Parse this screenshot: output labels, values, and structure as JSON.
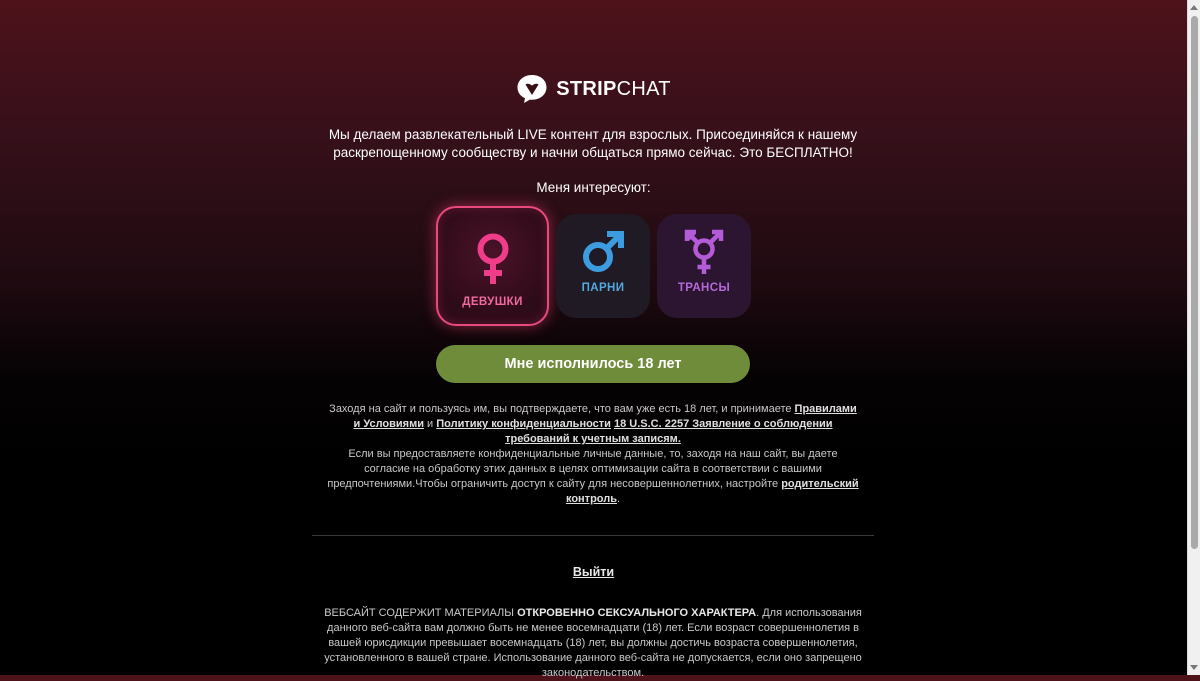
{
  "brand": {
    "name_bold": "STRIP",
    "name_regular": "CHAT",
    "logo_icon": "speech-bubble-heart-icon"
  },
  "intro": {
    "line1": "Мы делаем развлекательный LIVE контент для взрослых. Присоединяйся к нашему",
    "line2": "раскрепощенному сообществу и начни общаться прямо сейчас. Это БЕСПЛАТНО!"
  },
  "interests": {
    "label": "Меня интересуют:",
    "options": [
      {
        "label": "ДЕВУШКИ",
        "icon": "female-symbol-icon",
        "color": "#f03d8a",
        "selected": true
      },
      {
        "label": "ПАРНИ",
        "icon": "male-symbol-icon",
        "color": "#3d9be0",
        "selected": false
      },
      {
        "label": "ТРАНСЫ",
        "icon": "transgender-symbol-icon",
        "color": "#b45bd8",
        "selected": false
      }
    ]
  },
  "confirm_button": {
    "label": "Мне исполнилось 18 лет",
    "color": "#6e8c3a"
  },
  "legal": {
    "p1_start": "Заходя на сайт и пользуясь им, вы подтверждаете, что вам уже есть 18 лет, и принимаете ",
    "terms_link": "Правилами и Условиями",
    "p1_and": " и ",
    "privacy_link": "Политику конфиденциальности",
    "space": " ",
    "usc_link": "18 U.S.C. 2257 Заявление о соблюдении требований к учетным записям.",
    "p2_start": "Если вы предоставляете конфиденциальные личные данные, то, заходя на наш сайт, вы даете согласие на обработку этих данных в целях оптимизации сайта в соответствии с вашими предпочтениями.Чтобы ограничить доступ к сайту для несовершеннолетних, настройте ",
    "parental_link": "родительский контроль",
    "p2_end": "."
  },
  "exit": {
    "label": "Выйти"
  },
  "warning": {
    "start": "ВЕБСАЙТ СОДЕРЖИТ МАТЕРИАЛЫ ",
    "bold": "ОТКРОВЕННО СЕКСУАЛЬНОГО ХАРАКТЕРА",
    "rest": ". Для использования данного веб-сайта вам должно быть не менее восемнадцати (18) лет. Если возраст совершеннолетия в вашей юрисдикции превышает восемнадцать (18) лет, вы должны достичь возраста совершеннолетия, установленного в вашей стране. Использование данного веб-сайта не допускается, если оно запрещено законодательством."
  }
}
